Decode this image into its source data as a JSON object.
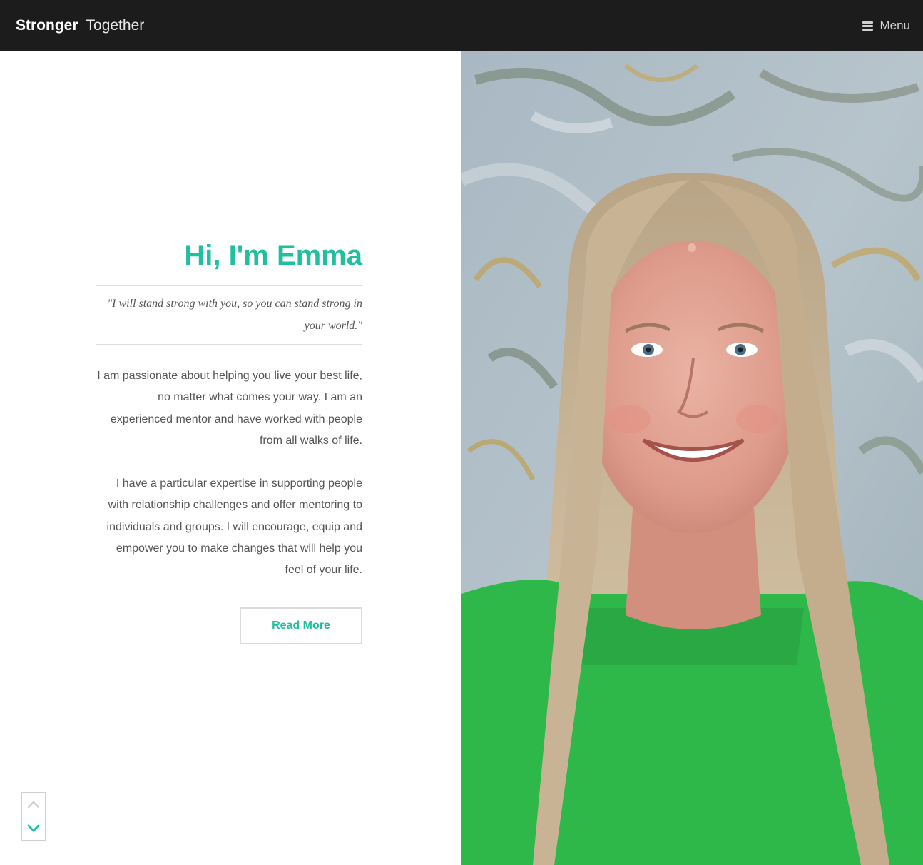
{
  "header": {
    "brand_bold": "Stronger",
    "brand_light": "Together",
    "menu_label": "Menu"
  },
  "main": {
    "title": "Hi, I'm Emma",
    "quote": "\"I will stand strong with you, so you can stand strong in your world.\"",
    "paragraph1": "I am passionate about helping you live your best life, no matter what comes your way. I am an experienced mentor and have worked with people from all walks of life.",
    "paragraph2": "I have a particular expertise in supporting people with relationship challenges and offer mentoring to individuals and groups. I will encourage, equip and empower you to make changes that will help you feel of your life.",
    "read_more_label": "Read More"
  },
  "icons": {
    "menu": "hamburger-icon",
    "up": "chevron-up-icon",
    "down": "chevron-down-icon"
  },
  "colors": {
    "accent": "#1fbf9f",
    "header_bg": "#1c1c1c",
    "sweater": "#2fb84a"
  }
}
